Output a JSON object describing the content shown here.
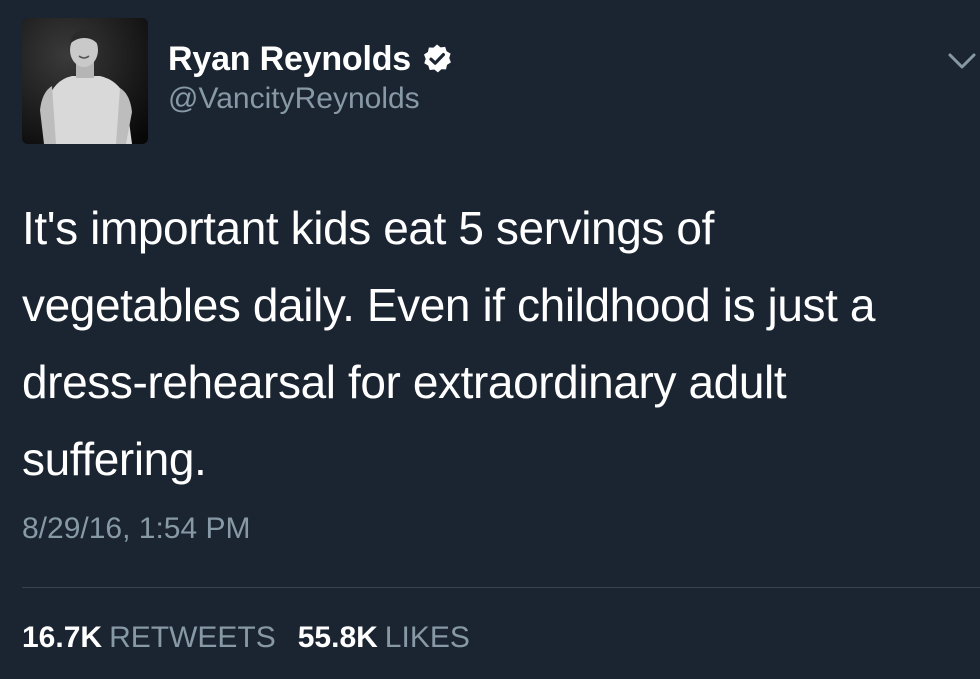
{
  "author": {
    "display_name": "Ryan Reynolds",
    "handle": "@VancityReynolds",
    "verified": true,
    "avatar_icon": "profile-photo"
  },
  "tweet": {
    "lines": [
      "It's important kids eat 5 servings of",
      "vegetables daily. Even if childhood is just a",
      "dress-rehearsal for extraordinary adult",
      "suffering."
    ],
    "timestamp": "8/29/16, 1:54 PM"
  },
  "stats": {
    "retweets_count": "16.7K",
    "retweets_label": "RETWEETS",
    "likes_count": "55.8K",
    "likes_label": "LIKES"
  },
  "colors": {
    "background": "#1b2532",
    "primary_text": "#ffffff",
    "secondary_text": "#8899a6",
    "divider": "#38444d"
  },
  "icons": {
    "verified": "verified-badge-icon",
    "menu": "chevron-down-icon"
  }
}
